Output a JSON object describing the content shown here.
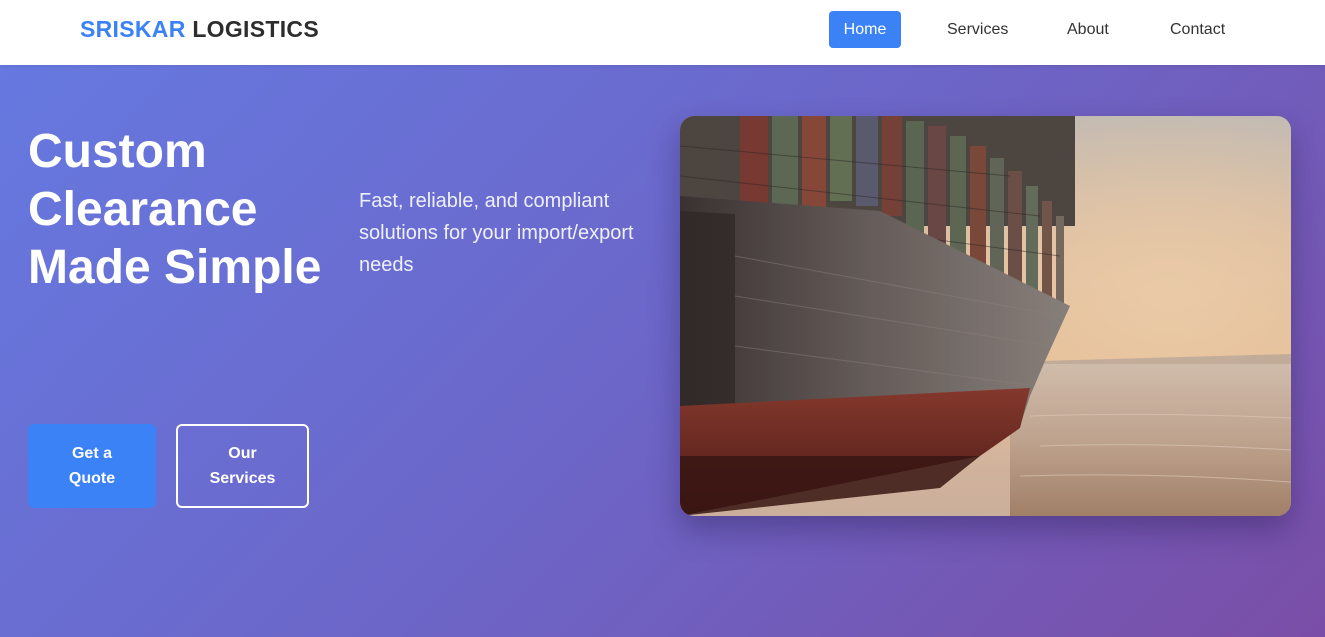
{
  "brand": {
    "accent": "SRISKAR",
    "rest": "LOGISTICS"
  },
  "nav": {
    "items": [
      {
        "label": "Home",
        "active": true
      },
      {
        "label": "Services",
        "active": false
      },
      {
        "label": "About",
        "active": false
      },
      {
        "label": "Contact",
        "active": false
      }
    ]
  },
  "hero": {
    "title": "Custom Clearance Made Simple",
    "subtitle": "Fast, reliable, and compliant solutions for your import/export needs",
    "primary_button": "Get a Quote",
    "secondary_button": "Our Services"
  },
  "colors": {
    "accent": "#3b82f6",
    "hero_gradient_start": "#6679e0",
    "hero_gradient_end": "#7a4ea7"
  }
}
